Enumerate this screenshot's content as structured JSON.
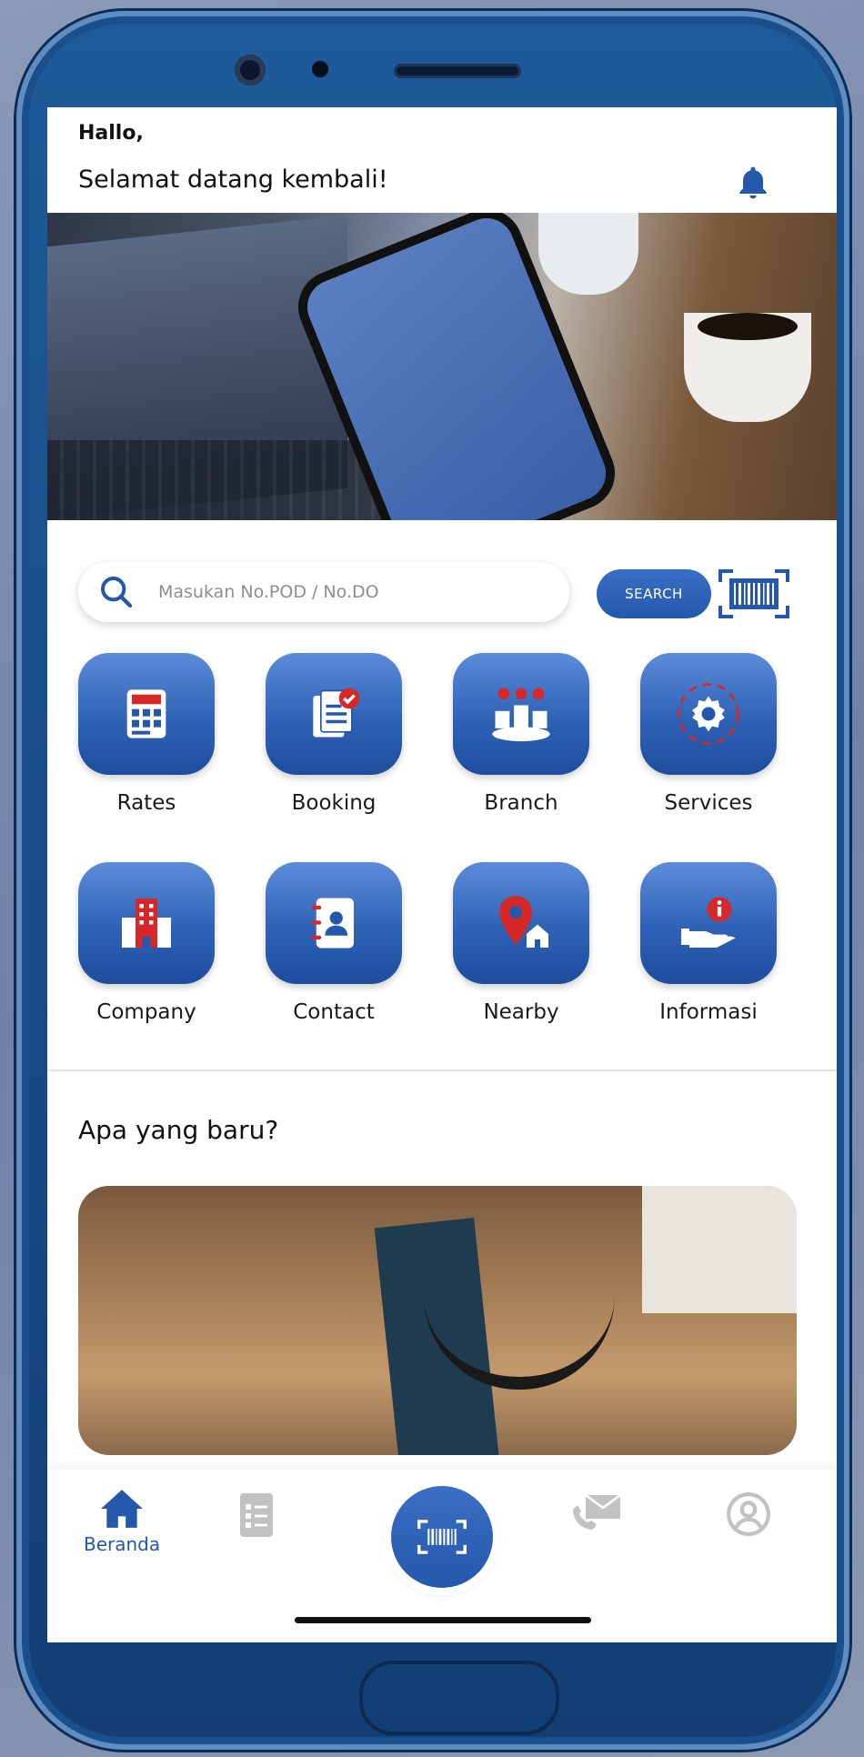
{
  "header": {
    "greeting": "Hallo,",
    "welcome": "Selamat datang kembali!",
    "notification_icon": "bell-icon"
  },
  "hero_carousel": {
    "slides": 2,
    "active_slide": 1
  },
  "search": {
    "placeholder": "Masukan No.POD / No.DO",
    "value": "",
    "button_label": "SEARCH",
    "scan_icon": "barcode-scan-icon"
  },
  "menu": [
    {
      "label": "Rates",
      "icon": "calculator-icon"
    },
    {
      "label": "Booking",
      "icon": "document-check-icon"
    },
    {
      "label": "Branch",
      "icon": "map-buildings-icon"
    },
    {
      "label": "Services",
      "icon": "gear-icon"
    },
    {
      "label": "Company",
      "icon": "building-icon"
    },
    {
      "label": "Contact",
      "icon": "address-book-icon"
    },
    {
      "label": "Nearby",
      "icon": "location-home-icon"
    },
    {
      "label": "Informasi",
      "icon": "info-hand-icon"
    }
  ],
  "news": {
    "title": "Apa yang baru?"
  },
  "tabbar": {
    "home_label": "Beranda",
    "items": [
      "home-icon",
      "list-icon",
      "barcode-scan-icon",
      "phone-mail-icon",
      "user-icon"
    ]
  },
  "colors": {
    "primary": "#2458ad",
    "accent_red": "#d62828",
    "device_frame": "#1f5a9a"
  }
}
